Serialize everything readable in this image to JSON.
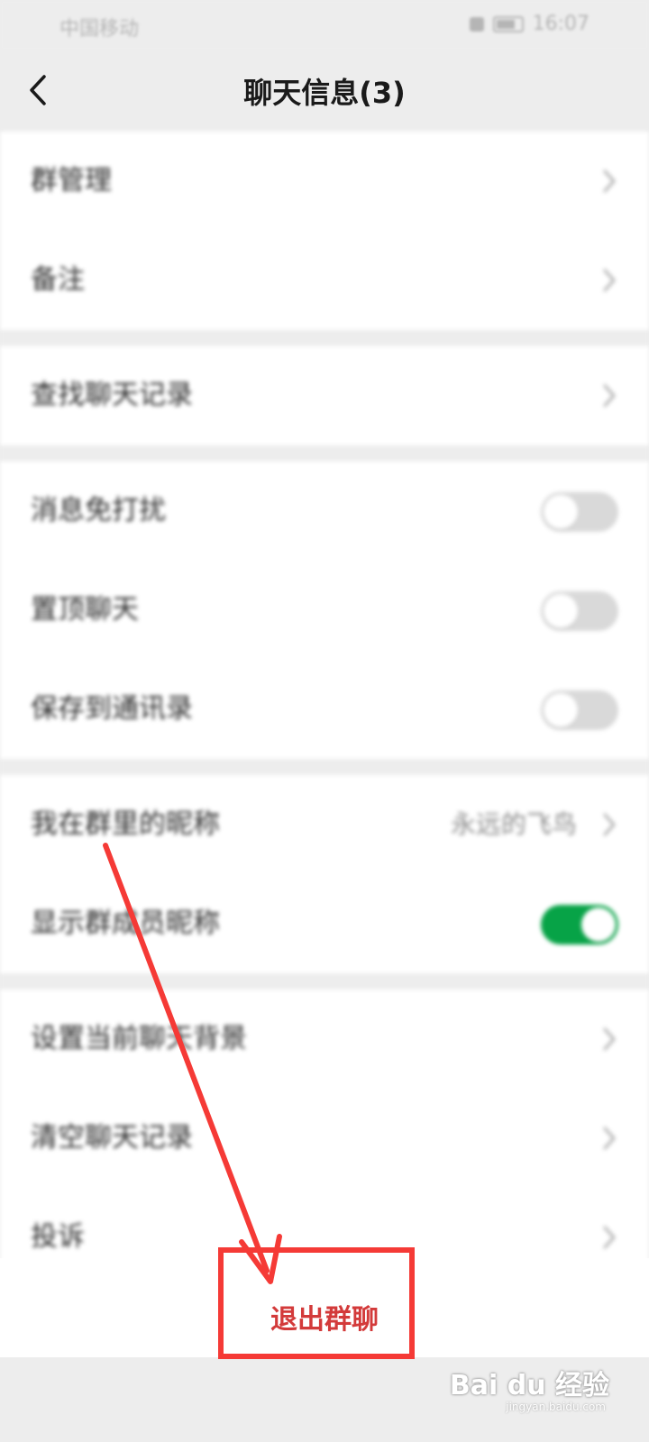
{
  "status_bar": {
    "carrier": "中国移动",
    "time": "16:07"
  },
  "nav": {
    "title": "聊天信息(3)",
    "back_icon": "chevron-left-icon"
  },
  "groups": [
    {
      "rows": [
        {
          "label": "群管理",
          "control": "chevron"
        },
        {
          "label": "备注",
          "control": "chevron"
        }
      ]
    },
    {
      "rows": [
        {
          "label": "查找聊天记录",
          "control": "chevron"
        }
      ]
    },
    {
      "rows": [
        {
          "label": "消息免打扰",
          "control": "toggle",
          "on": false
        },
        {
          "label": "置顶聊天",
          "control": "toggle",
          "on": false
        },
        {
          "label": "保存到通讯录",
          "control": "toggle",
          "on": false
        }
      ]
    },
    {
      "rows": [
        {
          "label": "我在群里的昵称",
          "control": "chevron",
          "value": "永远的飞鸟"
        },
        {
          "label": "显示群成员昵称",
          "control": "toggle",
          "on": true
        }
      ]
    },
    {
      "rows": [
        {
          "label": "设置当前聊天背景",
          "control": "chevron"
        },
        {
          "label": "清空聊天记录",
          "control": "chevron"
        },
        {
          "label": "投诉",
          "control": "chevron"
        }
      ]
    }
  ],
  "exit": {
    "label": "退出群聊"
  },
  "watermark": {
    "brand": "Bai du 经验",
    "url": "jingyan.baidu.com"
  },
  "colors": {
    "accent_green": "#07a347",
    "exit_red": "#d33a3a",
    "annotation_red": "#f53a36"
  }
}
